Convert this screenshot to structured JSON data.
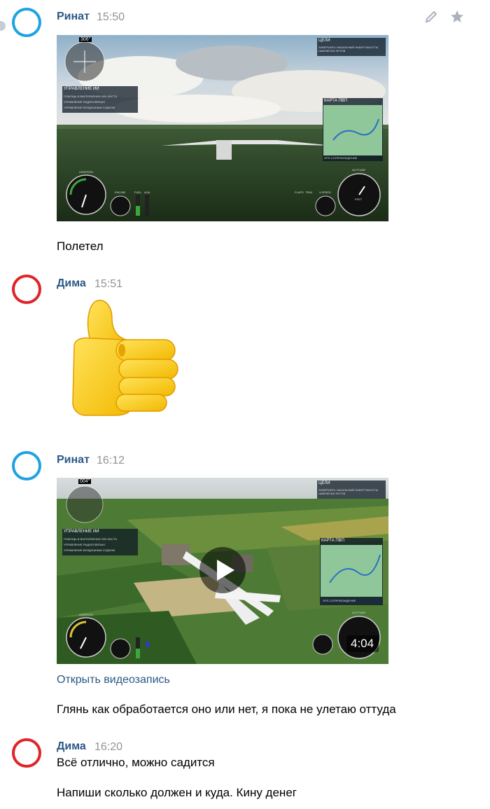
{
  "messages": [
    {
      "author": "Ринат",
      "time": "15:50",
      "text": "Полетел"
    },
    {
      "author": "Дима",
      "time": "15:51"
    },
    {
      "author": "Ринат",
      "time": "16:12",
      "link": "Открыть видеозапись",
      "text": "Глянь как обработается оно или нет, я пока не улетаю оттуда"
    },
    {
      "author": "Дима",
      "time": "16:20",
      "text": "Всё отлично, можно садится",
      "text2": "Напиши сколько должен и куда. Кину денег"
    }
  ],
  "screenshot1": {
    "compass": "306°",
    "ai_panel_title": "УПРАВЛЕНИЕ ИИ",
    "ai_items": [
      "ПОМОЩЬ В ВЫПОЛНЕНИИ ЧЕК-ЛИСТА",
      "УПРАВЛЕНИЕ РАДИОСВЯЗЬЮ",
      "УПРАВЛЕНИЕ ВОЗДУШНЫМ СУДНОМ"
    ],
    "goals_title": "ЦЕЛИ",
    "goals_text": "ЗАВЕРШИТЬ НАЧАЛЬНЫЙ НАБОР ВЫСОТЫ НАБРАВ 500 ФУТОВ",
    "map_title": "КАРТА ПВП",
    "map_footer": "GPS-СОПРОВОЖДЕНИЕ",
    "airspeed": "AIRSPEED",
    "engine": "ENGINE",
    "fuel": "FUEL",
    "aoa": "AOA",
    "flaps": "FLAPS",
    "trim": "TRIM",
    "vspeed": "V.SPEED",
    "altitude": "ALTITUDE",
    "feet": "FEET"
  },
  "screenshot2": {
    "compass": "004°",
    "ai_panel_title": "УПРАВЛЕНИЕ ИИ",
    "ai_items": [
      "ПОМОЩЬ В ВЫПОЛНЕНИИ ЧЕК-ЛИСТА",
      "УПРАВЛЕНИЕ РАДИОСВЯЗЬЮ",
      "УПРАВЛЕНИЕ ВОЗДУШНЫМ СУДНОМ"
    ],
    "goals_title": "ЦЕЛИ",
    "goals_text": "ЗАВЕРШИТЬ НАЧАЛЬНЫЙ НАБОР ВЫСОТЫ НАБРАВ 500 ФУТОВ",
    "map_title": "КАРТА ПВП",
    "map_footer": "GPS-СОПРОВОЖДЕНИЕ",
    "airspeed": "AIRSPEED",
    "altitude": "ALTITUDE",
    "duration": "4:04"
  },
  "icons": [
    "pencil-icon",
    "star-icon",
    "play-icon",
    "thumbs-up-sticker"
  ],
  "colors": {
    "author": "#2a5885",
    "time": "#939393",
    "avatar_blue": "#1fa3e0",
    "avatar_red": "#e0242a"
  }
}
